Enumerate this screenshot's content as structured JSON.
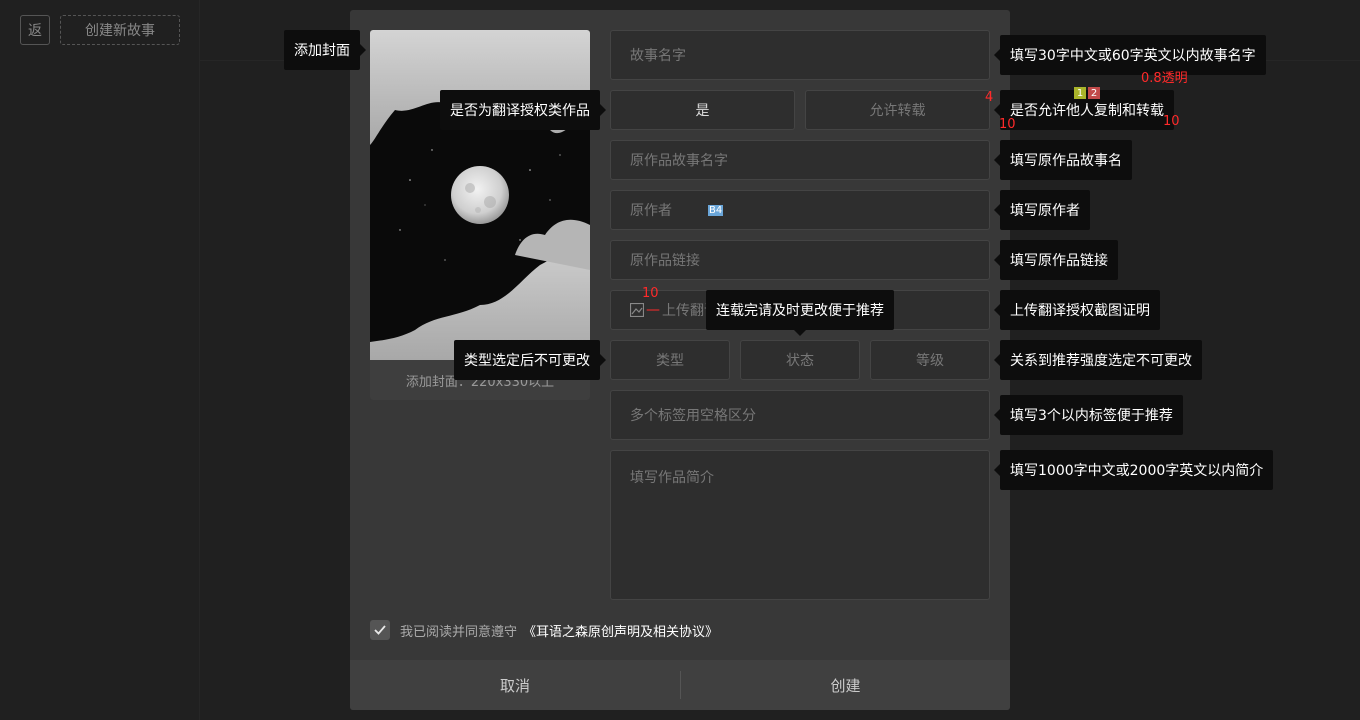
{
  "background": {
    "back_button": "返",
    "create_story_button": "创建新故事"
  },
  "cover": {
    "hint": "添加封面：220x330以上"
  },
  "form": {
    "story_name_placeholder": "故事名字",
    "translation_yes": "是",
    "allow_repost": "允许转载",
    "original_name_placeholder": "原作品故事名字",
    "original_author_placeholder": "原作者",
    "original_link_placeholder": "原作品链接",
    "upload_label": "上传翻译",
    "type_select": "类型",
    "status_select": "状态",
    "level_select": "等级",
    "tags_placeholder": "多个标签用空格区分",
    "intro_placeholder": "填写作品简介"
  },
  "tooltips": {
    "add_cover": "添加封面",
    "is_translation": "是否为翻译授权类作品",
    "story_name_hint": "填写30字中文或60字英文以内故事名字",
    "repost_hint": "是否允许他人复制和转载",
    "original_name_hint": "填写原作品故事名",
    "original_author_hint": "填写原作者",
    "original_link_hint": "填写原作品链接",
    "upload_hint": "上传翻译授权截图证明",
    "status_hint": "连载完请及时更改便于推荐",
    "type_hint": "类型选定后不可更改",
    "level_hint": "关系到推荐强度选定不可更改",
    "tags_hint": "填写3个以内标签便于推荐",
    "intro_hint": "填写1000字中文或2000字英文以内简介"
  },
  "annotations": {
    "opacity": "0.8透明",
    "badge_1": "1",
    "badge_2": "2",
    "num_4": "4",
    "num_10_a": "10",
    "num_10_b": "10",
    "num_10_c": "10",
    "sel_badge": "B4"
  },
  "agreement": {
    "text": "我已阅读并同意遵守",
    "link": "《耳语之森原创声明及相关协议》",
    "checked": true
  },
  "footer": {
    "cancel": "取消",
    "create": "创建"
  },
  "colors": {
    "background": "#202020",
    "modal": "#383838",
    "field": "#2e2e2e",
    "tooltip": "#0d0d0d",
    "annotation_red": "#ff2a2a"
  }
}
